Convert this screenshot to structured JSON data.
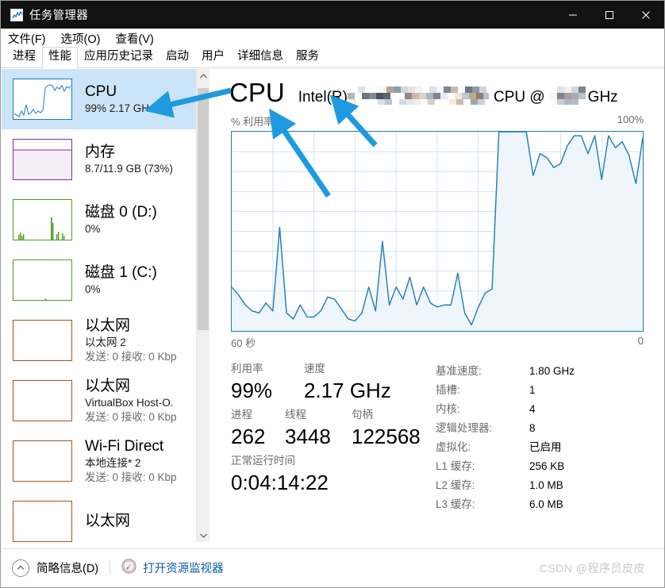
{
  "window": {
    "title": "任务管理器",
    "icon": "task-manager-icon",
    "minimize": "—",
    "maximize": "□",
    "close": "✕"
  },
  "menu": [
    {
      "label": "文件(F)"
    },
    {
      "label": "选项(O)"
    },
    {
      "label": "查看(V)"
    }
  ],
  "tabs": [
    {
      "label": "进程",
      "active": false
    },
    {
      "label": "性能",
      "active": true
    },
    {
      "label": "应用历史记录",
      "active": false
    },
    {
      "label": "启动",
      "active": false
    },
    {
      "label": "用户",
      "active": false
    },
    {
      "label": "详细信息",
      "active": false
    },
    {
      "label": "服务",
      "active": false
    }
  ],
  "sidebar": {
    "items": [
      {
        "name": "cpu",
        "title": "CPU",
        "sub1": "99% 2.17 GHz",
        "sub2": "",
        "sub3": "",
        "selected": true,
        "color": "#1b7bb8",
        "thumb": "line"
      },
      {
        "name": "memory",
        "title": "内存",
        "sub1": "8.7/11.9 GB (73%)",
        "sub2": "",
        "sub3": "",
        "selected": false,
        "color": "#8c26b0",
        "thumb": "fill"
      },
      {
        "name": "disk-0",
        "title": "磁盘 0 (D:)",
        "sub1": "0%",
        "sub2": "",
        "sub3": "",
        "selected": false,
        "color": "#4a9e21",
        "thumb": "spikes"
      },
      {
        "name": "disk-1",
        "title": "磁盘 1 (C:)",
        "sub1": "0%",
        "sub2": "",
        "sub3": "",
        "selected": false,
        "color": "#4a9e21",
        "thumb": "flat"
      },
      {
        "name": "ethernet-1",
        "title": "以太网",
        "sub1": "以太网 2",
        "sub2": "发送: 0 接收: 0 Kbp",
        "sub3": "",
        "selected": false,
        "color": "#a8531a",
        "thumb": "empty"
      },
      {
        "name": "ethernet-2",
        "title": "以太网",
        "sub1": "VirtualBox Host-O.",
        "sub2": "发送: 0 接收: 0 Kbp",
        "sub3": "",
        "selected": false,
        "color": "#a8531a",
        "thumb": "empty"
      },
      {
        "name": "wifi-direct",
        "title": "Wi-Fi Direct",
        "sub1": "本地连接* 2",
        "sub2": "发送: 0 接收: 0 Kbp",
        "sub3": "",
        "selected": false,
        "color": "#a8531a",
        "thumb": "empty"
      },
      {
        "name": "ethernet-3",
        "title": "以太网",
        "sub1": "",
        "sub2": "",
        "sub3": "",
        "selected": false,
        "color": "#a8531a",
        "thumb": "empty"
      }
    ],
    "scrollbar": {
      "up_arrow": "⌃",
      "down_arrow": "⌄"
    }
  },
  "main": {
    "heading": "CPU",
    "model_prefix": "Intel(R)",
    "model_at": "CPU @",
    "model_unit": "GHz",
    "model_redacted": true,
    "graph": {
      "y_axis_label": "% 利用率",
      "y_max_label": "100%",
      "x_left_label": "60 秒",
      "x_right_label": "0",
      "line_color": "#1b7bb8",
      "fill_color": "#eef5fb",
      "grid_color": "#cfe3f2"
    },
    "stats": {
      "utilization_label": "利用率",
      "utilization_value": "99%",
      "speed_label": "速度",
      "speed_value": "2.17 GHz",
      "processes_label": "进程",
      "processes_value": "262",
      "threads_label": "线程",
      "threads_value": "3448",
      "handles_label": "句柄",
      "handles_value": "122568",
      "uptime_label": "正常运行时间",
      "uptime_value": "0:04:14:22"
    },
    "specs": [
      {
        "key": "基准速度:",
        "value": "1.80 GHz"
      },
      {
        "key": "插槽:",
        "value": "1"
      },
      {
        "key": "内核:",
        "value": "4"
      },
      {
        "key": "逻辑处理器:",
        "value": "8"
      },
      {
        "key": "虚拟化:",
        "value": "已启用"
      },
      {
        "key": "L1 缓存:",
        "value": "256 KB"
      },
      {
        "key": "L2 缓存:",
        "value": "1.0 MB"
      },
      {
        "key": "L3 缓存:",
        "value": "6.0 MB"
      }
    ]
  },
  "statusbar": {
    "fewer_details": "简略信息(D)",
    "fewer_icon": "chevron-up-circle-icon",
    "resource_monitor": "打开资源监视器",
    "resource_icon": "resource-monitor-icon"
  },
  "watermark": "CSDN @程序员皮皮",
  "annotation": {
    "arrow_color": "#1e9ae0",
    "arrows": 2
  },
  "chart_data": {
    "type": "area",
    "title": "CPU 利用率",
    "ylabel": "% 利用率",
    "xlabel": "60 秒",
    "ylim": [
      0,
      100
    ],
    "xlim": [
      60,
      0
    ],
    "grid": true,
    "x": [
      0,
      1,
      2,
      3,
      4,
      5,
      6,
      7,
      8,
      9,
      10,
      11,
      12,
      13,
      14,
      15,
      16,
      17,
      18,
      19,
      20,
      21,
      22,
      23,
      24,
      25,
      26,
      27,
      28,
      29,
      30,
      31,
      32,
      33,
      34,
      35,
      36,
      37,
      38,
      39,
      40,
      41,
      42,
      43,
      44,
      45,
      46,
      47,
      48,
      49,
      50,
      51,
      52,
      53,
      54,
      55,
      56,
      57,
      58,
      59,
      60
    ],
    "values": [
      22,
      18,
      13,
      10,
      9,
      14,
      10,
      52,
      9,
      6,
      13,
      7,
      7,
      10,
      17,
      16,
      11,
      6,
      5,
      9,
      22,
      10,
      45,
      13,
      22,
      16,
      27,
      13,
      22,
      14,
      12,
      13,
      13,
      29,
      9,
      3,
      12,
      19,
      21,
      100,
      100,
      100,
      100,
      100,
      78,
      89,
      87,
      82,
      84,
      93,
      98,
      98,
      89,
      98,
      76,
      98,
      92,
      95,
      88,
      74,
      97
    ],
    "unit": "%"
  }
}
